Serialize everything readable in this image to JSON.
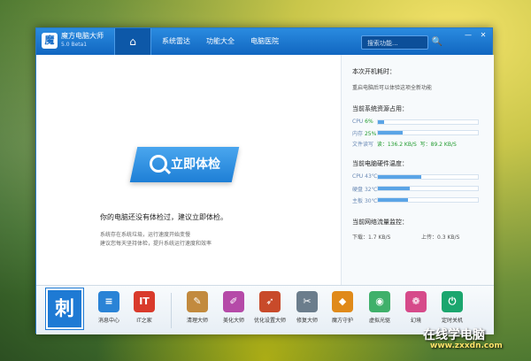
{
  "app": {
    "name": "魔方电脑大师",
    "version": "5.0 Beta1",
    "logo_char": "魔"
  },
  "nav": {
    "home_icon": "⌂",
    "items": [
      "系统雷达",
      "功能大全",
      "电脑医院"
    ]
  },
  "search": {
    "placeholder": "搜索功能...",
    "icon": "🔍"
  },
  "window_buttons": {
    "min": "—",
    "close": "✕"
  },
  "main": {
    "check_button": "立即体检",
    "message": "你的电脑还没有体检过，建议立即体检。",
    "sub_lines": [
      "系统存在系统垃圾，运行速度开始变慢",
      "建议您每天坚持体检，提升系统运行速度和效率"
    ]
  },
  "side": {
    "boot_title": "本次开机耗时：",
    "boot_text": "重启电脑后可以体验这项全新功能",
    "res_title": "当前系统资源占用：",
    "cpu": {
      "label": "CPU",
      "value": "6%",
      "fill": 0.06
    },
    "mem": {
      "label": "内存",
      "value": "25%",
      "fill": 0.25
    },
    "disk": {
      "label": "文件读写",
      "read": "读：136.2 KB/S",
      "write": "写：89.2 KB/S"
    },
    "temp_title": "当前电脑硬件温度：",
    "temps": [
      {
        "label": "CPU",
        "value": "43℃",
        "fill": 0.43
      },
      {
        "label": "硬盘",
        "value": "32℃",
        "fill": 0.32
      },
      {
        "label": "主板",
        "value": "30℃",
        "fill": 0.3
      }
    ],
    "net_title": "当前网络流量监控：",
    "download": "下载：1.7 KB/S",
    "upload": "上传：0.3 KB/S"
  },
  "toolbar": {
    "logo_char": "刺",
    "items": [
      {
        "label": "消息中心",
        "icon": "≡",
        "color": "#2a83d6"
      },
      {
        "label": "IT之家",
        "icon": "IT",
        "color": "#d93a2b"
      },
      {
        "label": "清理大师",
        "icon": "✎",
        "color": "#c28a3e"
      },
      {
        "label": "美化大师",
        "icon": "✐",
        "color": "#b54aa8"
      },
      {
        "label": "优化设置大师",
        "icon": "➶",
        "color": "#c84a2a"
      },
      {
        "label": "修复大师",
        "icon": "✂",
        "color": "#6b7d8c"
      },
      {
        "label": "魔方守护",
        "icon": "◆",
        "color": "#e08a1a"
      },
      {
        "label": "虚拟光驱",
        "icon": "◉",
        "color": "#3fb06a"
      },
      {
        "label": "幻境",
        "icon": "❁",
        "color": "#d64a8a"
      },
      {
        "label": "定时关机",
        "icon": "⏻",
        "color": "#1ba66e"
      }
    ]
  },
  "watermark": {
    "cn": "在线学电脑",
    "url": "www.zxxdn.com"
  }
}
